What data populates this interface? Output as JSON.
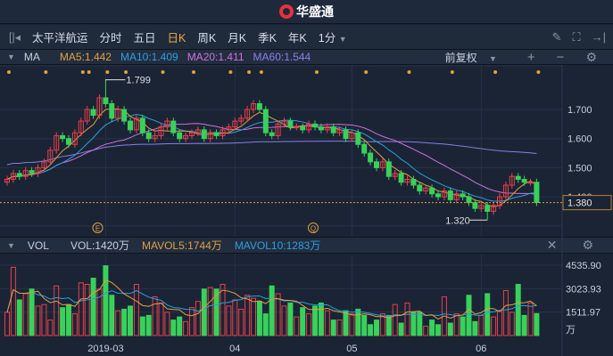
{
  "app": {
    "title": "华盛通"
  },
  "toolbar": {
    "stock_name": "太平洋航运",
    "tabs": [
      "分时",
      "五日",
      "日K",
      "周K",
      "月K",
      "季K",
      "年K"
    ],
    "active_tab": "日K",
    "interval": "1分"
  },
  "ma_header": {
    "label": "MA",
    "ma5": "MA5:1.442",
    "ma10": "MA10:1.409",
    "ma20": "MA20:1.411",
    "ma60": "MA60:1.544",
    "adjust": "前复权"
  },
  "vol_header": {
    "label": "VOL",
    "vol": "VOL:1420万",
    "mavol5": "MAVOL5:1744万",
    "mavol10": "MAVOL10:1283万"
  },
  "colors": {
    "up": "#e8404a",
    "down": "#38d15a",
    "ma5": "#e0a040",
    "ma10": "#2aa0e0",
    "ma20": "#d070e0",
    "ma60": "#8a7fe8",
    "bg": "#1b2435"
  },
  "price_axis": {
    "ticks": [
      "1.700",
      "1.600",
      "1.500",
      "1.400"
    ],
    "current": "1.380"
  },
  "vol_axis": {
    "ticks": [
      "4535.90",
      "3023.93",
      "1511.97"
    ],
    "unit": "万"
  },
  "x_axis": {
    "labels": [
      "2019-03",
      "04",
      "05",
      "06"
    ]
  },
  "annotations": {
    "max": "1.799",
    "min": "1.320",
    "events": [
      "E",
      "Q"
    ]
  },
  "chart_data": {
    "type": "candlestick",
    "open": [
      1.45,
      1.46,
      1.48,
      1.47,
      1.49,
      1.48,
      1.5,
      1.52,
      1.56,
      1.61,
      1.6,
      1.58,
      1.62,
      1.66,
      1.7,
      1.68,
      1.74,
      1.72,
      1.67,
      1.7,
      1.66,
      1.63,
      1.67,
      1.62,
      1.6,
      1.61,
      1.64,
      1.66,
      1.62,
      1.6,
      1.61,
      1.62,
      1.63,
      1.6,
      1.62,
      1.61,
      1.63,
      1.64,
      1.66,
      1.67,
      1.7,
      1.72,
      1.7,
      1.62,
      1.61,
      1.65,
      1.66,
      1.64,
      1.64,
      1.63,
      1.65,
      1.64,
      1.63,
      1.64,
      1.62,
      1.63,
      1.6,
      1.62,
      1.58,
      1.55,
      1.52,
      1.5,
      1.52,
      1.47,
      1.48,
      1.45,
      1.46,
      1.44,
      1.42,
      1.43,
      1.41,
      1.4,
      1.42,
      1.39,
      1.41,
      1.4,
      1.38,
      1.36,
      1.37,
      1.35,
      1.37,
      1.4,
      1.44,
      1.47,
      1.46,
      1.45,
      1.45
    ],
    "close": [
      1.46,
      1.48,
      1.47,
      1.49,
      1.48,
      1.5,
      1.52,
      1.56,
      1.61,
      1.6,
      1.58,
      1.62,
      1.66,
      1.7,
      1.68,
      1.74,
      1.72,
      1.67,
      1.7,
      1.66,
      1.63,
      1.67,
      1.62,
      1.6,
      1.61,
      1.64,
      1.66,
      1.62,
      1.6,
      1.61,
      1.62,
      1.63,
      1.6,
      1.62,
      1.61,
      1.63,
      1.64,
      1.66,
      1.67,
      1.7,
      1.72,
      1.7,
      1.62,
      1.61,
      1.65,
      1.66,
      1.64,
      1.64,
      1.63,
      1.65,
      1.64,
      1.63,
      1.64,
      1.62,
      1.63,
      1.6,
      1.62,
      1.58,
      1.55,
      1.52,
      1.5,
      1.52,
      1.47,
      1.48,
      1.45,
      1.46,
      1.44,
      1.42,
      1.43,
      1.41,
      1.4,
      1.42,
      1.39,
      1.41,
      1.4,
      1.38,
      1.36,
      1.37,
      1.35,
      1.37,
      1.4,
      1.44,
      1.47,
      1.46,
      1.45,
      1.45,
      1.38
    ],
    "volume": [
      1500,
      4400,
      2300,
      2700,
      3000,
      1900,
      2000,
      1000,
      3200,
      1800,
      2000,
      1400,
      3400,
      3300,
      3700,
      3000,
      4500,
      2600,
      1600,
      1700,
      1900,
      3300,
      1200,
      1300,
      2500,
      2100,
      1500,
      1000,
      1200,
      900,
      1800,
      2200,
      3000,
      3100,
      3000,
      3300,
      1900,
      2300,
      1700,
      2600,
      2400,
      2200,
      1400,
      3200,
      2700,
      1900,
      2100,
      1200,
      1800,
      1400,
      1900,
      2100,
      1600,
      1000,
      1000,
      1600,
      1400,
      1700,
      1300,
      700,
      1000,
      1400,
      1300,
      2000,
      800,
      2100,
      1500,
      1500,
      600,
      1000,
      700,
      2500,
      800,
      1400,
      1200,
      2600,
      900,
      1300,
      2700,
      1200,
      1600,
      2900,
      1500,
      3300,
      1300,
      2100,
      1420
    ],
    "max_index": 16,
    "max_value": 1.799,
    "min_index": 78,
    "min_value": 1.32,
    "month_start_index": [
      16,
      37,
      56,
      77
    ],
    "event_index": [
      15,
      50
    ],
    "price_range": [
      1.25,
      1.85
    ],
    "volume_range": [
      0,
      5000
    ]
  }
}
